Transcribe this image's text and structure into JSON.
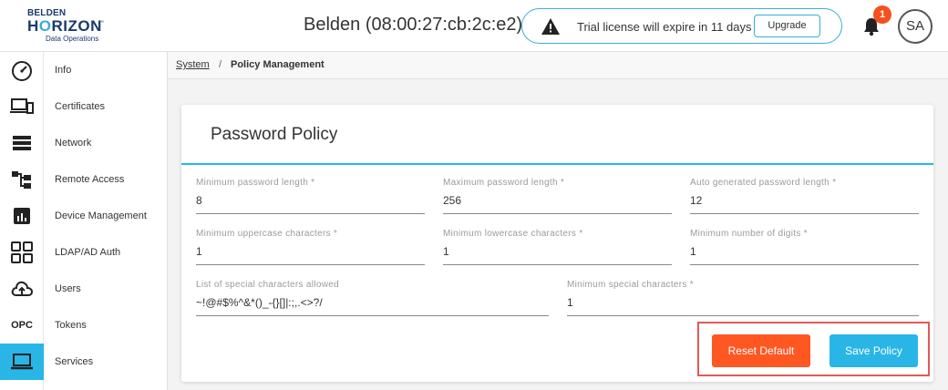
{
  "logo": {
    "line1": "BELDEN",
    "line2_a": "H",
    "line2_o": "O",
    "line2_b": "RIZON",
    "tm": "™",
    "line3": "Data Operations"
  },
  "header": {
    "device_title": "Belden (08:00:27:cb:2c:e2)",
    "trial_message": "Trial license will expire in 11 days",
    "upgrade_label": "Upgrade",
    "notification_count": "1",
    "avatar_initials": "SA"
  },
  "rail": {
    "items": [
      "dashboard-icon",
      "devices-icon",
      "list-icon",
      "topology-icon",
      "reports-icon",
      "apps-icon",
      "cloud-upload-icon",
      "opc-label",
      "laptop-icon"
    ],
    "opc_label": "OPC",
    "active_index": 8
  },
  "subnav": {
    "items": [
      "Info",
      "Certificates",
      "Network",
      "Remote Access",
      "Device Management",
      "LDAP/AD Auth",
      "Users",
      "Tokens",
      "Services"
    ]
  },
  "breadcrumb": {
    "parent": "System",
    "separator": "/",
    "current": "Policy Management"
  },
  "card": {
    "title": "Password Policy",
    "fields": {
      "min_length": {
        "label": "Minimum password length *",
        "value": "8"
      },
      "max_length": {
        "label": "Maximum password length *",
        "value": "256"
      },
      "auto_length": {
        "label": "Auto generated password length *",
        "value": "12"
      },
      "min_upper": {
        "label": "Minimum uppercase characters *",
        "value": "1"
      },
      "min_lower": {
        "label": "Minimum lowercase characters *",
        "value": "1"
      },
      "min_digits": {
        "label": "Minimum number of digits *",
        "value": "1"
      },
      "special_allowed": {
        "label": "List of special characters allowed",
        "value": "~!@#$%^&*()_-{}[]|:;,.<>?/"
      },
      "min_special": {
        "label": "Minimum special characters *",
        "value": "1"
      }
    }
  },
  "actions": {
    "reset_label": "Reset Default",
    "save_label": "Save Policy"
  },
  "colors": {
    "accent": "#29b6e7",
    "reset": "#ff5722",
    "badge": "#f4511e",
    "highlight": "#e05a57"
  }
}
